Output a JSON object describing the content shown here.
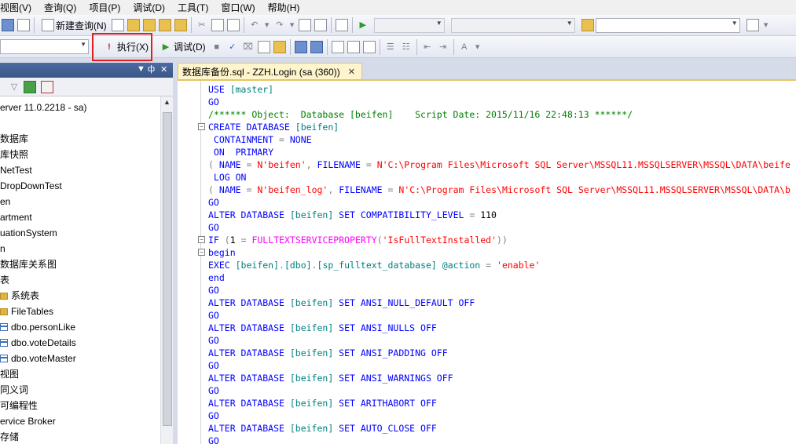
{
  "menu": [
    "视图(V)",
    "查询(Q)",
    "项目(P)",
    "调试(D)",
    "工具(T)",
    "窗口(W)",
    "帮助(H)"
  ],
  "toolbar": {
    "new_query_label": "新建查询(N)",
    "execute_label": "执行(X)",
    "debug_label": "调试(D)",
    "database_combo": "",
    "search_combo": ""
  },
  "tab": {
    "title": "数据库备份.sql - ZZH.Login (sa (360))",
    "close": "✕"
  },
  "tree": {
    "items": [
      {
        "text": "erver 11.0.2218 - sa)",
        "icon": "none"
      },
      {
        "text": "",
        "icon": "none"
      },
      {
        "text": "数据库",
        "icon": "none"
      },
      {
        "text": "库快照",
        "icon": "none"
      },
      {
        "text": "NetTest",
        "icon": "none"
      },
      {
        "text": "DropDownTest",
        "icon": "none"
      },
      {
        "text": "en",
        "icon": "none"
      },
      {
        "text": "artment",
        "icon": "none"
      },
      {
        "text": "uationSystem",
        "icon": "none"
      },
      {
        "text": "n",
        "icon": "none"
      },
      {
        "text": "数据库关系图",
        "icon": "none"
      },
      {
        "text": "表",
        "icon": "none"
      },
      {
        "text": "系统表",
        "icon": "folder"
      },
      {
        "text": "FileTables",
        "icon": "folder"
      },
      {
        "text": "dbo.personLike",
        "icon": "table"
      },
      {
        "text": "dbo.voteDetails",
        "icon": "table"
      },
      {
        "text": "dbo.voteMaster",
        "icon": "table"
      },
      {
        "text": "视图",
        "icon": "none"
      },
      {
        "text": "同义词",
        "icon": "none"
      },
      {
        "text": "可编程性",
        "icon": "none"
      },
      {
        "text": "ervice Broker",
        "icon": "none"
      },
      {
        "text": "存储",
        "icon": "none"
      }
    ]
  },
  "code": [
    [
      [
        "kw",
        "USE "
      ],
      [
        "obj",
        "[master]"
      ]
    ],
    [
      [
        "kw",
        "GO"
      ]
    ],
    [
      [
        "cm",
        "/****** Object:  Database [beifen]    Script Date: 2015/11/16 22:48:13 ******/"
      ]
    ],
    [
      [
        "kw",
        "CREATE DATABASE "
      ],
      [
        "obj",
        "[beifen]"
      ]
    ],
    [
      [
        "kw",
        " CONTAINMENT "
      ],
      [
        "op",
        "= "
      ],
      [
        "kw",
        "NONE"
      ]
    ],
    [
      [
        "kw",
        " ON  PRIMARY"
      ]
    ],
    [
      [
        "op",
        "( "
      ],
      [
        "kw",
        "NAME "
      ],
      [
        "op",
        "= "
      ],
      [
        "str",
        "N'beifen'"
      ],
      [
        "op",
        ", "
      ],
      [
        "kw",
        "FILENAME "
      ],
      [
        "op",
        "= "
      ],
      [
        "str",
        "N'C:\\Program Files\\Microsoft SQL Server\\MSSQL11.MSSQLSERVER\\MSSQL\\DATA\\beife"
      ]
    ],
    [
      [
        "kw",
        " LOG ON"
      ]
    ],
    [
      [
        "op",
        "( "
      ],
      [
        "kw",
        "NAME "
      ],
      [
        "op",
        "= "
      ],
      [
        "str",
        "N'beifen_log'"
      ],
      [
        "op",
        ", "
      ],
      [
        "kw",
        "FILENAME "
      ],
      [
        "op",
        "= "
      ],
      [
        "str",
        "N'C:\\Program Files\\Microsoft SQL Server\\MSSQL11.MSSQLSERVER\\MSSQL\\DATA\\b"
      ]
    ],
    [
      [
        "kw",
        "GO"
      ]
    ],
    [
      [
        "kw",
        "ALTER DATABASE "
      ],
      [
        "obj",
        "[beifen] "
      ],
      [
        "kw",
        "SET COMPATIBILITY_LEVEL "
      ],
      [
        "op",
        "= "
      ],
      [
        "plain",
        "110"
      ]
    ],
    [
      [
        "kw",
        "GO"
      ]
    ],
    [
      [
        "kw",
        "IF "
      ],
      [
        "op",
        "("
      ],
      [
        "plain",
        "1 "
      ],
      [
        "op",
        "= "
      ],
      [
        "fn",
        "FULLTEXTSERVICEPROPERTY"
      ],
      [
        "op",
        "("
      ],
      [
        "str",
        "'IsFullTextInstalled'"
      ],
      [
        "op",
        "))"
      ]
    ],
    [
      [
        "kw",
        "begin"
      ]
    ],
    [
      [
        "kw",
        "EXEC "
      ],
      [
        "obj",
        "[beifen]"
      ],
      [
        "op",
        "."
      ],
      [
        "obj",
        "[dbo]"
      ],
      [
        "op",
        "."
      ],
      [
        "obj",
        "[sp_fulltext_database] "
      ],
      [
        "obj",
        "@action "
      ],
      [
        "op",
        "= "
      ],
      [
        "str",
        "'enable'"
      ]
    ],
    [
      [
        "kw",
        "end"
      ]
    ],
    [
      [
        "kw",
        "GO"
      ]
    ],
    [
      [
        "kw",
        "ALTER DATABASE "
      ],
      [
        "obj",
        "[beifen] "
      ],
      [
        "kw",
        "SET ANSI_NULL_DEFAULT OFF"
      ]
    ],
    [
      [
        "kw",
        "GO"
      ]
    ],
    [
      [
        "kw",
        "ALTER DATABASE "
      ],
      [
        "obj",
        "[beifen] "
      ],
      [
        "kw",
        "SET ANSI_NULLS OFF"
      ]
    ],
    [
      [
        "kw",
        "GO"
      ]
    ],
    [
      [
        "kw",
        "ALTER DATABASE "
      ],
      [
        "obj",
        "[beifen] "
      ],
      [
        "kw",
        "SET ANSI_PADDING OFF"
      ]
    ],
    [
      [
        "kw",
        "GO"
      ]
    ],
    [
      [
        "kw",
        "ALTER DATABASE "
      ],
      [
        "obj",
        "[beifen] "
      ],
      [
        "kw",
        "SET ANSI_WARNINGS OFF"
      ]
    ],
    [
      [
        "kw",
        "GO"
      ]
    ],
    [
      [
        "kw",
        "ALTER DATABASE "
      ],
      [
        "obj",
        "[beifen] "
      ],
      [
        "kw",
        "SET ARITHABORT OFF"
      ]
    ],
    [
      [
        "kw",
        "GO"
      ]
    ],
    [
      [
        "kw",
        "ALTER DATABASE "
      ],
      [
        "obj",
        "[beifen] "
      ],
      [
        "kw",
        "SET AUTO_CLOSE OFF"
      ]
    ],
    [
      [
        "kw",
        "GO"
      ]
    ]
  ],
  "folds": [
    3,
    12,
    13
  ]
}
